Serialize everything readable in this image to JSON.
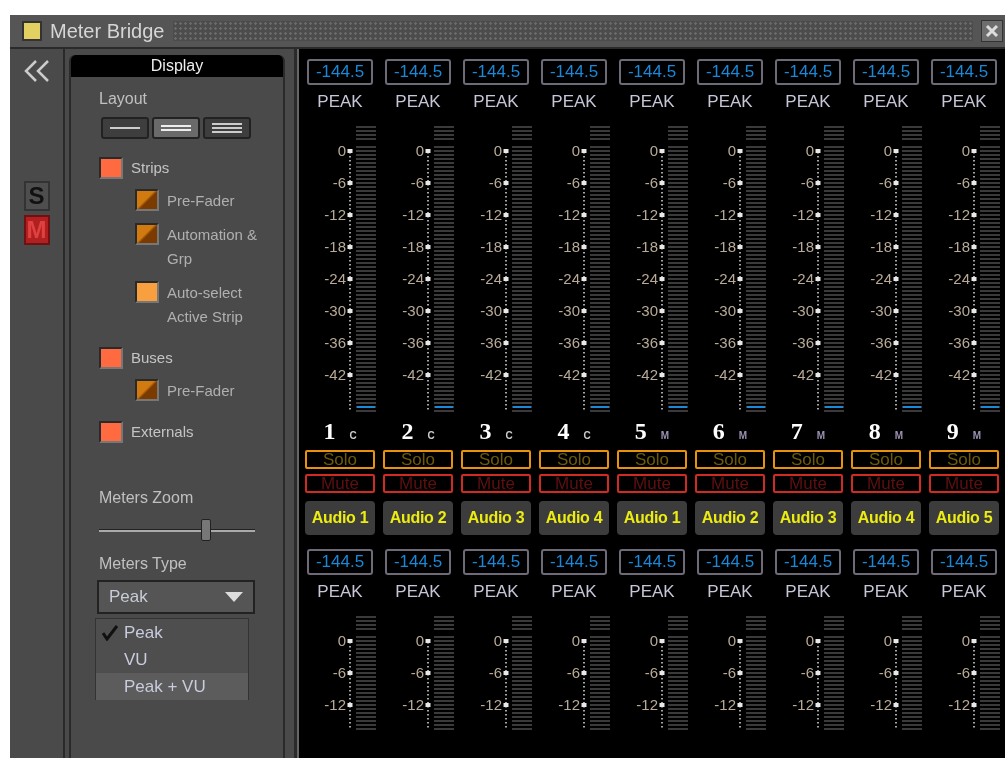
{
  "window": {
    "title": "Meter Bridge"
  },
  "side_buttons": [
    {
      "label": "S",
      "on": false
    },
    {
      "label": "M",
      "on": true
    }
  ],
  "display_panel": {
    "title": "Display",
    "layout_label": "Layout",
    "layout_options": [
      {
        "selected": false
      },
      {
        "selected": true
      },
      {
        "selected": false
      }
    ],
    "options": [
      {
        "label": "Strips",
        "checked": true,
        "children": [
          {
            "label": "Pre-Fader",
            "checked": false
          },
          {
            "label": "Automation & Grp",
            "checked": false
          },
          {
            "label": "Auto-select Active Strip",
            "checked": true
          }
        ]
      },
      {
        "label": "Buses",
        "checked": true,
        "children": [
          {
            "label": "Pre-Fader",
            "checked": false
          }
        ]
      },
      {
        "label": "Externals",
        "checked": true
      }
    ],
    "zoom": {
      "label": "Meters Zoom",
      "level": 0.69
    },
    "meters_type": {
      "label": "Meters Type",
      "value": "Peak",
      "menu": [
        {
          "label": "Peak",
          "selected": true,
          "hovered": false
        },
        {
          "label": "VU",
          "selected": false,
          "hovered": false
        },
        {
          "label": "Peak + VU",
          "selected": false,
          "hovered": true
        }
      ]
    }
  },
  "strips": [
    {
      "reading": "-144.5",
      "meter_type": "PEAK",
      "scale": [
        "0",
        "-6",
        "-12",
        "-18",
        "-24",
        "-30",
        "-36",
        "-42"
      ],
      "number": "1",
      "mode": "C",
      "solo": "Solo",
      "mute": "Mute",
      "name": "Audio 1"
    },
    {
      "reading": "-144.5",
      "meter_type": "PEAK",
      "scale": [
        "0",
        "-6",
        "-12",
        "-18",
        "-24",
        "-30",
        "-36",
        "-42"
      ],
      "number": "2",
      "mode": "C",
      "solo": "Solo",
      "mute": "Mute",
      "name": "Audio 2"
    },
    {
      "reading": "-144.5",
      "meter_type": "PEAK",
      "scale": [
        "0",
        "-6",
        "-12",
        "-18",
        "-24",
        "-30",
        "-36",
        "-42"
      ],
      "number": "3",
      "mode": "C",
      "solo": "Solo",
      "mute": "Mute",
      "name": "Audio 3"
    },
    {
      "reading": "-144.5",
      "meter_type": "PEAK",
      "scale": [
        "0",
        "-6",
        "-12",
        "-18",
        "-24",
        "-30",
        "-36",
        "-42"
      ],
      "number": "4",
      "mode": "C",
      "solo": "Solo",
      "mute": "Mute",
      "name": "Audio 4"
    },
    {
      "reading": "-144.5",
      "meter_type": "PEAK",
      "scale": [
        "0",
        "-6",
        "-12",
        "-18",
        "-24",
        "-30",
        "-36",
        "-42"
      ],
      "number": "5",
      "mode": "M",
      "solo": "Solo",
      "mute": "Mute",
      "name": "Audio 1"
    },
    {
      "reading": "-144.5",
      "meter_type": "PEAK",
      "scale": [
        "0",
        "-6",
        "-12",
        "-18",
        "-24",
        "-30",
        "-36",
        "-42"
      ],
      "number": "6",
      "mode": "M",
      "solo": "Solo",
      "mute": "Mute",
      "name": "Audio 2"
    },
    {
      "reading": "-144.5",
      "meter_type": "PEAK",
      "scale": [
        "0",
        "-6",
        "-12",
        "-18",
        "-24",
        "-30",
        "-36",
        "-42"
      ],
      "number": "7",
      "mode": "M",
      "solo": "Solo",
      "mute": "Mute",
      "name": "Audio 3"
    },
    {
      "reading": "-144.5",
      "meter_type": "PEAK",
      "scale": [
        "0",
        "-6",
        "-12",
        "-18",
        "-24",
        "-30",
        "-36",
        "-42"
      ],
      "number": "8",
      "mode": "M",
      "solo": "Solo",
      "mute": "Mute",
      "name": "Audio 4"
    },
    {
      "reading": "-144.5",
      "meter_type": "PEAK",
      "scale": [
        "0",
        "-6",
        "-12",
        "-18",
        "-24",
        "-30",
        "-36",
        "-42"
      ],
      "number": "9",
      "mode": "M",
      "solo": "Solo",
      "mute": "Mute",
      "name": "Audio 5"
    }
  ],
  "lower_strips": [
    {
      "reading": "-144.5",
      "meter_type": "PEAK",
      "scale": [
        "0",
        "-6",
        "-12"
      ]
    },
    {
      "reading": "-144.5",
      "meter_type": "PEAK",
      "scale": [
        "0",
        "-6",
        "-12"
      ]
    },
    {
      "reading": "-144.5",
      "meter_type": "PEAK",
      "scale": [
        "0",
        "-6",
        "-12"
      ]
    },
    {
      "reading": "-144.5",
      "meter_type": "PEAK",
      "scale": [
        "0",
        "-6",
        "-12"
      ]
    },
    {
      "reading": "-144.5",
      "meter_type": "PEAK",
      "scale": [
        "0",
        "-6",
        "-12"
      ]
    },
    {
      "reading": "-144.5",
      "meter_type": "PEAK",
      "scale": [
        "0",
        "-6",
        "-12"
      ]
    },
    {
      "reading": "-144.5",
      "meter_type": "PEAK",
      "scale": [
        "0",
        "-6",
        "-12"
      ]
    },
    {
      "reading": "-144.5",
      "meter_type": "PEAK",
      "scale": [
        "0",
        "-6",
        "-12"
      ]
    },
    {
      "reading": "-144.5",
      "meter_type": "PEAK",
      "scale": [
        "0",
        "-6",
        "-12"
      ]
    }
  ]
}
